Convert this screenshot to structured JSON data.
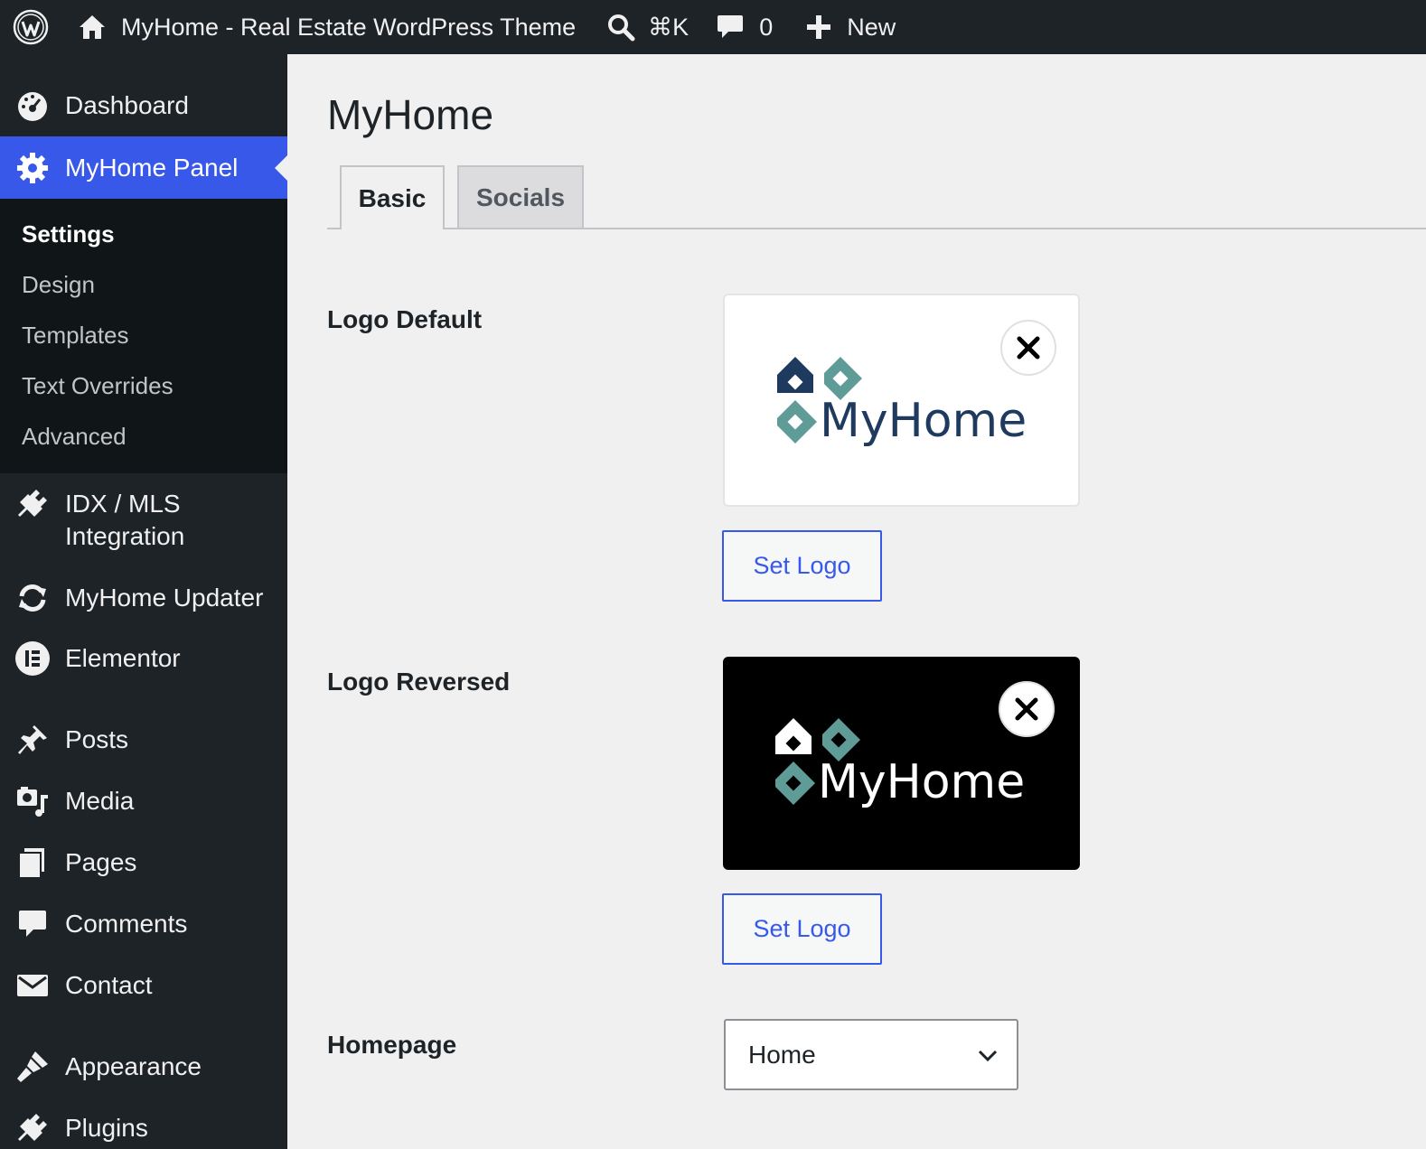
{
  "adminbar": {
    "site_name": "MyHome - Real Estate WordPress Theme",
    "search_shortcut": "⌘K",
    "comments_count": "0",
    "new_label": "New"
  },
  "sidebar": {
    "dashboard": "Dashboard",
    "myhome_panel": "MyHome Panel",
    "submenu": [
      "Settings",
      "Design",
      "Templates",
      "Text Overrides",
      "Advanced"
    ],
    "idx_line1": "IDX / MLS",
    "idx_line2": "Integration",
    "updater": "MyHome Updater",
    "elementor": "Elementor",
    "posts": "Posts",
    "media": "Media",
    "pages": "Pages",
    "comments": "Comments",
    "contact": "Contact",
    "appearance": "Appearance",
    "plugins": "Plugins"
  },
  "main": {
    "title": "MyHome",
    "tabs": [
      "Basic",
      "Socials"
    ],
    "logo_default_label": "Logo Default",
    "logo_reversed_label": "Logo Reversed",
    "logo_wordmark": "MyHome",
    "set_logo": "Set Logo",
    "homepage_label": "Homepage",
    "homepage_value": "Home"
  },
  "colors": {
    "accent": "#3858e9",
    "logo_navy": "#1f3a5f",
    "logo_teal": "#5f9c98"
  }
}
